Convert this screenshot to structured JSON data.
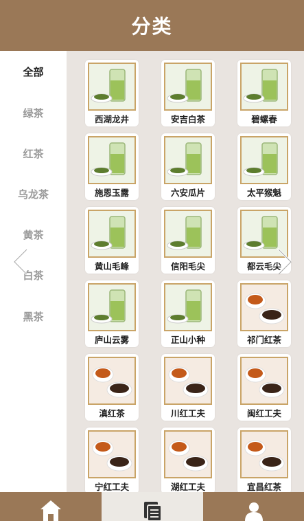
{
  "header": {
    "title": "分类"
  },
  "sidebar": {
    "items": [
      {
        "label": "全部",
        "active": true
      },
      {
        "label": "绿茶",
        "active": false
      },
      {
        "label": "红茶",
        "active": false
      },
      {
        "label": "乌龙茶",
        "active": false
      },
      {
        "label": "黄茶",
        "active": false
      },
      {
        "label": "白茶",
        "active": false
      },
      {
        "label": "黑茶",
        "active": false
      }
    ]
  },
  "products": [
    {
      "name": "西湖龙井",
      "kind": "green"
    },
    {
      "name": "安吉白茶",
      "kind": "green"
    },
    {
      "name": "碧螺春",
      "kind": "green"
    },
    {
      "name": "施恩玉露",
      "kind": "green"
    },
    {
      "name": "六安瓜片",
      "kind": "green"
    },
    {
      "name": "太平猴魁",
      "kind": "green"
    },
    {
      "name": "黄山毛峰",
      "kind": "green"
    },
    {
      "name": "信阳毛尖",
      "kind": "green"
    },
    {
      "name": "都云毛尖",
      "kind": "green"
    },
    {
      "name": "庐山云雾",
      "kind": "green"
    },
    {
      "name": "正山小种",
      "kind": "green"
    },
    {
      "name": "祁门红茶",
      "kind": "red"
    },
    {
      "name": "滇红茶",
      "kind": "red"
    },
    {
      "name": "川红工夫",
      "kind": "red"
    },
    {
      "name": "闽红工夫",
      "kind": "red"
    },
    {
      "name": "宁红工夫",
      "kind": "red"
    },
    {
      "name": "湖红工夫",
      "kind": "red"
    },
    {
      "name": "宜昌红茶",
      "kind": "red"
    }
  ],
  "nav": {
    "prev_icon": "chevron-left-icon",
    "next_icon": "chevron-right-icon"
  },
  "tabbar": {
    "items": [
      {
        "icon": "home-icon",
        "active": false
      },
      {
        "icon": "category-icon",
        "active": true
      },
      {
        "icon": "user-icon",
        "active": false
      }
    ]
  },
  "colors": {
    "brand": "#9a7857",
    "thumb_border": "#c9a467",
    "content_bg": "#e9e4e0"
  }
}
